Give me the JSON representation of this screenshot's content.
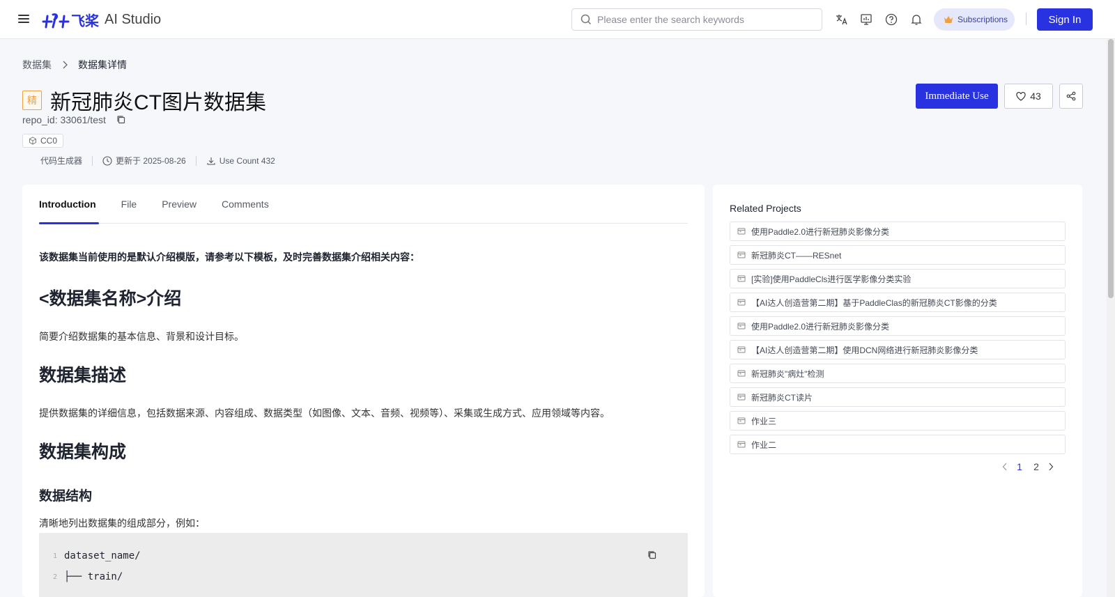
{
  "header": {
    "logo_mark": "ꟼꟼ",
    "logo_cn": "飞桨",
    "logo_en": "AI Studio",
    "search_placeholder": "Please enter the search keywords",
    "subscriptions": "Subscriptions",
    "sign_in": "Sign In"
  },
  "breadcrumb": {
    "parent": "数据集",
    "current": "数据集详情"
  },
  "dataset": {
    "badge": "精",
    "title": "新冠肺炎CT图片数据集",
    "repo_id": "repo_id: 33061/test",
    "license": "CC0",
    "meta": {
      "generator": "代码生成器",
      "updated": "更新于 2025-08-26",
      "use_count": "Use Count 432"
    },
    "immediate_use": "Immediate Use",
    "likes": "43"
  },
  "tabs": [
    "Introduction",
    "File",
    "Preview",
    "Comments"
  ],
  "intro": {
    "note": "该数据集当前使用的是默认介绍模版，请参考以下模板，及时完善数据集介绍相关内容：",
    "h_name": "<数据集名称>介绍",
    "p_name": "简要介绍数据集的基本信息、背景和设计目标。",
    "h_desc": "数据集描述",
    "p_desc": "提供数据集的详细信息，包括数据来源、内容组成、数据类型（如图像、文本、音频、视频等）、采集或生成方式、应用领域等内容。",
    "h_struct": "数据集构成",
    "h_sub": "数据结构",
    "p_struct": "清晰地列出数据集的组成部分，例如：",
    "code": [
      {
        "ln": "1",
        "text": "dataset_name/"
      },
      {
        "ln": "2",
        "text": "├── train/"
      }
    ]
  },
  "related": {
    "title": "Related Projects",
    "items": [
      "使用Paddle2.0进行新冠肺炎影像分类",
      "新冠肺炎CT——RESnet",
      "[实验]使用PaddleCls进行医学影像分类实验",
      "【AI达人创造营第二期】基于PaddleClas的新冠肺炎CT影像的分类",
      "使用Paddle2.0进行新冠肺炎影像分类",
      "【AI达人创造营第二期】使用DCN网络进行新冠肺炎影像分类",
      "新冠肺炎\"病灶\"检测",
      "新冠肺炎CT读片",
      "作业三",
      "作业二"
    ],
    "pages": [
      "1",
      "2"
    ],
    "current_page": "1"
  },
  "colors": {
    "brand": "#2932e1",
    "badge": "#f0a040"
  }
}
